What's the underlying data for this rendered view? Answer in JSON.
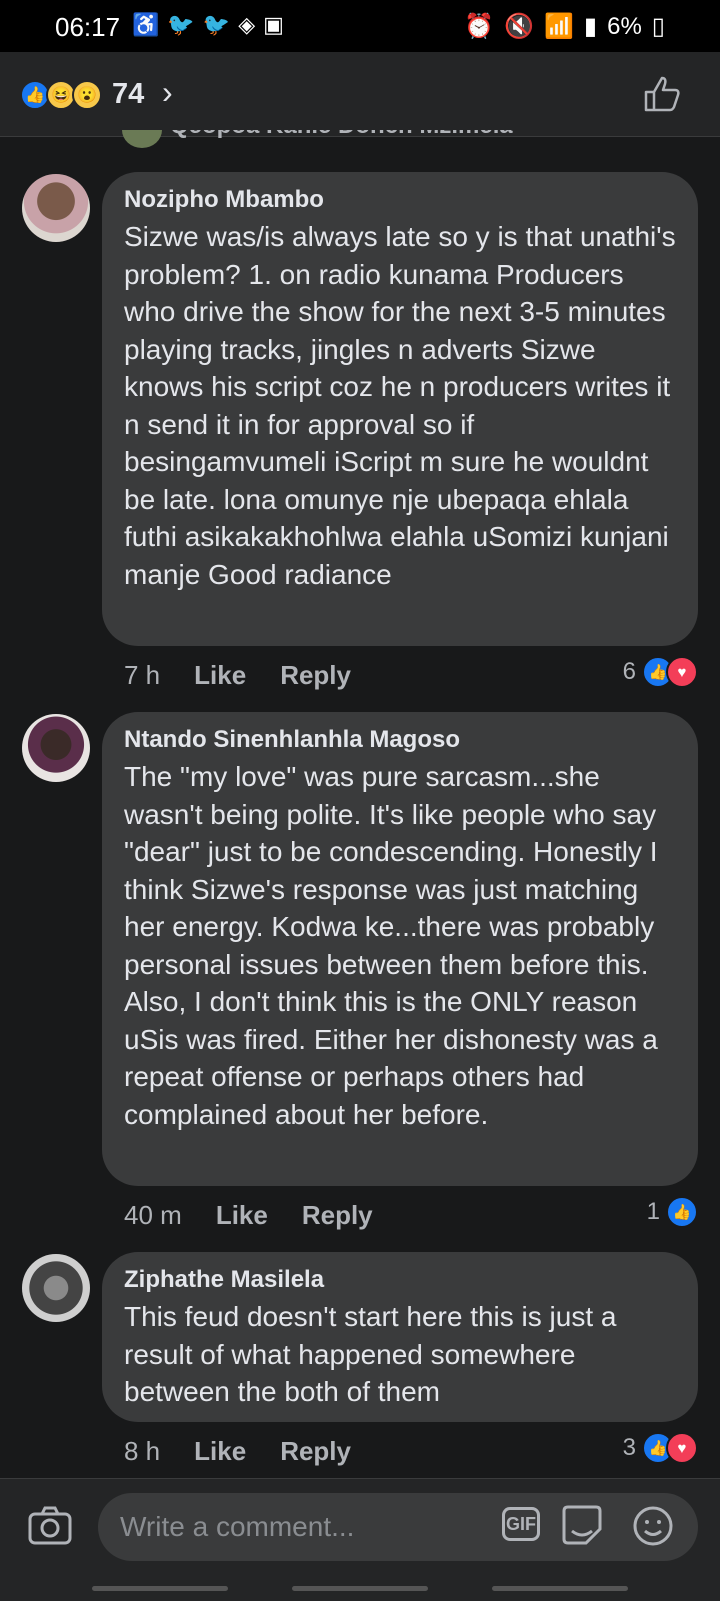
{
  "status_bar": {
    "time": "06:17",
    "battery": "6%"
  },
  "header": {
    "reaction_count": "74",
    "reaction_types": [
      "like",
      "haha",
      "wow"
    ]
  },
  "partial_comment": {
    "name": "Qeopoa Kanle Donch Mzimela"
  },
  "comments": [
    {
      "author": "Nozipho Mbambo",
      "text": "Sizwe was/is always late so y is that unathi's problem? 1. on radio kunama Producers who drive the show for the next 3-5 minutes playing tracks, jingles n adverts Sizwe knows his script coz he n producers writes it n send it in for approval so if besingamvumeli iScript m sure he wouldnt be late. lona omunye nje ubepaqa ehlala futhi asikakakhohlwa elahla uSomizi kunjani manje Good radiance",
      "time": "7 h",
      "like_label": "Like",
      "reply_label": "Reply",
      "reaction_count": "6",
      "reactions": [
        "like",
        "love"
      ]
    },
    {
      "author": "Ntando Sinenhlanhla Magoso",
      "text": "The \"my love\" was pure sarcasm...she wasn't being polite. It's like people who say \"dear\" just to be condescending. Honestly I think Sizwe's response was just matching her energy. Kodwa ke...there was probably personal issues between them before this. Also, I don't think this is the ONLY reason uSis was fired. Either her dishonesty was a repeat offense or perhaps others had complained about her before.",
      "time": "40 m",
      "like_label": "Like",
      "reply_label": "Reply",
      "reaction_count": "1",
      "reactions": [
        "like"
      ]
    },
    {
      "author": "Ziphathe Masilela",
      "text": "This feud doesn't start here this is just a result of what happened somewhere between the both of them",
      "time": "8 h",
      "like_label": "Like",
      "reply_label": "Reply",
      "reaction_count": "3",
      "reactions": [
        "like",
        "love"
      ]
    }
  ],
  "composer": {
    "placeholder": "Write a comment...",
    "gif_label": "GIF"
  },
  "colors": {
    "background": "#18191a",
    "bubble": "#3a3b3c",
    "like_blue": "#1877f2",
    "love_red": "#f33e58"
  }
}
